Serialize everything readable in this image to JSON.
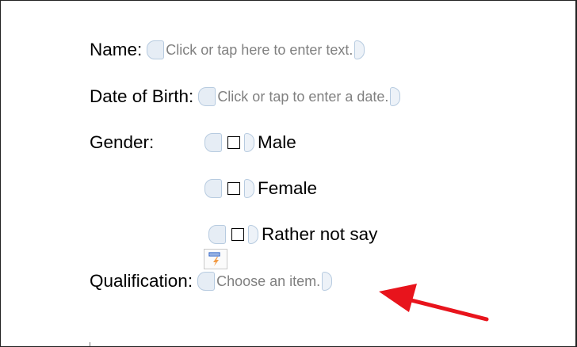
{
  "form": {
    "name": {
      "label": "Name:",
      "placeholder": "Click or tap here to enter text."
    },
    "dob": {
      "label": "Date of Birth:",
      "placeholder": "Click or tap to enter a date."
    },
    "gender": {
      "label": "Gender:",
      "options": [
        {
          "label": "Male",
          "checked": false
        },
        {
          "label": "Female",
          "checked": false
        },
        {
          "label": "Rather not say",
          "checked": false
        }
      ]
    },
    "qualification": {
      "label": "Qualification:",
      "placeholder": "Choose an item."
    }
  },
  "colors": {
    "control_tab_fill": "#e6edf5",
    "control_tab_border": "#b7cbe0",
    "placeholder_text": "#808080",
    "arrow": "#e8141c",
    "handle_icon_blue": "#2f64c9",
    "handle_icon_orange": "#f08a24"
  },
  "icons": {
    "content_control_handle": "dropdown-list-properties-icon",
    "annotation": "red-pointer-arrow"
  }
}
